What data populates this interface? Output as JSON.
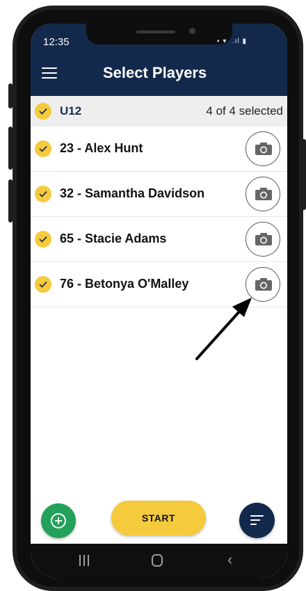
{
  "status_bar": {
    "time": "12:35"
  },
  "app_bar": {
    "title": "Select Players",
    "menu_icon": "hamburger-menu-icon"
  },
  "group": {
    "name": "U12",
    "selected_text": "4 of 4 selected",
    "checked": true
  },
  "players": [
    {
      "label": "23 - Alex Hunt",
      "checked": true
    },
    {
      "label": "32 - Samantha Davidson",
      "checked": true
    },
    {
      "label": "65 - Stacie Adams",
      "checked": true
    },
    {
      "label": "76 - Betonya O'Malley",
      "checked": true
    }
  ],
  "actions": {
    "add_icon": "plus-circle-icon",
    "start_label": "START",
    "sort_icon": "sort-lines-icon"
  },
  "colors": {
    "app_bar": "#13294b",
    "accent_yellow": "#f5ca3c",
    "add_green": "#23a15a",
    "nav_bar": "#0f0f0f"
  },
  "annotation": {
    "icon": "pointer-arrow-icon"
  }
}
